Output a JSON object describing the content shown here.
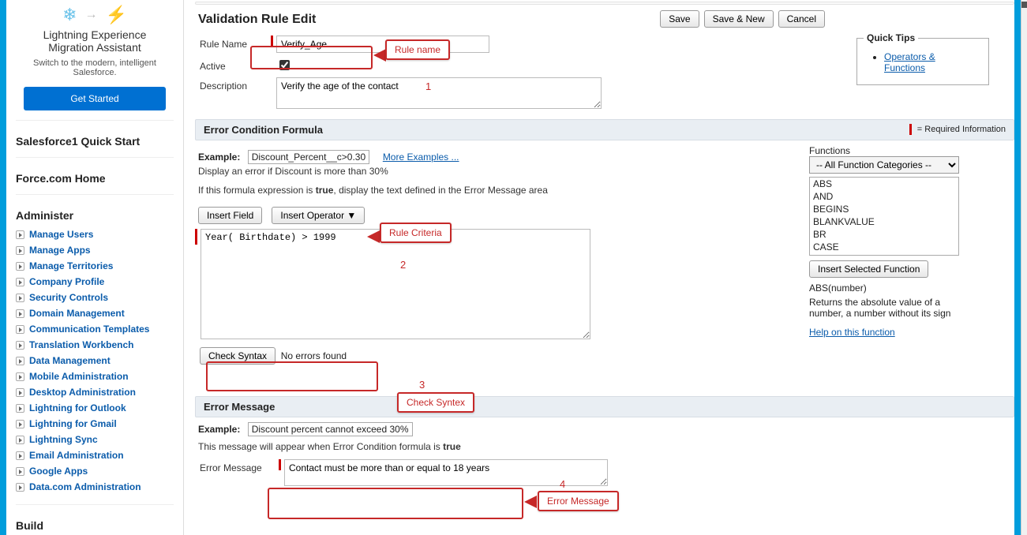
{
  "promo": {
    "title_line1": "Lightning Experience",
    "title_line2": "Migration Assistant",
    "subtitle": "Switch to the modern, intelligent Salesforce.",
    "cta": "Get Started"
  },
  "sidebar": {
    "quick_start": "Salesforce1 Quick Start",
    "home": "Force.com Home",
    "administer": "Administer",
    "build": "Build",
    "items": [
      "Manage Users",
      "Manage Apps",
      "Manage Territories",
      "Company Profile",
      "Security Controls",
      "Domain Management",
      "Communication Templates",
      "Translation Workbench",
      "Data Management",
      "Mobile Administration",
      "Desktop Administration",
      "Lightning for Outlook",
      "Lightning for Gmail",
      "Lightning Sync",
      "Email Administration",
      "Google Apps",
      "Data.com Administration"
    ]
  },
  "header": {
    "title": "Validation Rule Edit",
    "save": "Save",
    "save_new": "Save & New",
    "cancel": "Cancel"
  },
  "form": {
    "rule_name_label": "Rule Name",
    "rule_name_value": "Verify_Age",
    "active_label": "Active",
    "active_value": true,
    "description_label": "Description",
    "description_value": "Verify the age of the contact"
  },
  "quick_tips": {
    "title": "Quick Tips",
    "link1": "Operators & Functions"
  },
  "condition": {
    "title": "Error Condition Formula",
    "required_note": "= Required Information",
    "example_label": "Example:",
    "example_code": "Discount_Percent__c>0.30",
    "more_examples": "More Examples ...",
    "example_desc": "Display an error if Discount is more than 30%",
    "explain": "If this formula expression is true, display the text defined in the Error Message area",
    "insert_field": "Insert Field",
    "insert_operator": "Insert Operator ▼",
    "formula_value": "Year( Birthdate) > 1999",
    "check_syntax": "Check Syntax",
    "syntax_result": "No errors found"
  },
  "functions": {
    "label": "Functions",
    "selected": "-- All Function Categories --",
    "list": [
      "ABS",
      "AND",
      "BEGINS",
      "BLANKVALUE",
      "BR",
      "CASE"
    ],
    "insert_btn": "Insert Selected Function",
    "sig": "ABS(number)",
    "desc": "Returns the absolute value of a number, a number without its sign",
    "help": "Help on this function"
  },
  "error_msg": {
    "title": "Error Message",
    "example_label": "Example:",
    "example_text": "Discount percent cannot exceed 30%",
    "explain_prefix": "This message will appear when Error Condition formula is ",
    "explain_bold": "true",
    "field_label": "Error Message",
    "value": "Contact must be more than or equal to 18 years"
  },
  "annotations": {
    "rule_name": "Rule name",
    "rule_criteria": "Rule Criteria",
    "check_syntax": "Check Syntex",
    "error_message": "Error Message",
    "n1": "1",
    "n2": "2",
    "n3": "3",
    "n4": "4"
  }
}
